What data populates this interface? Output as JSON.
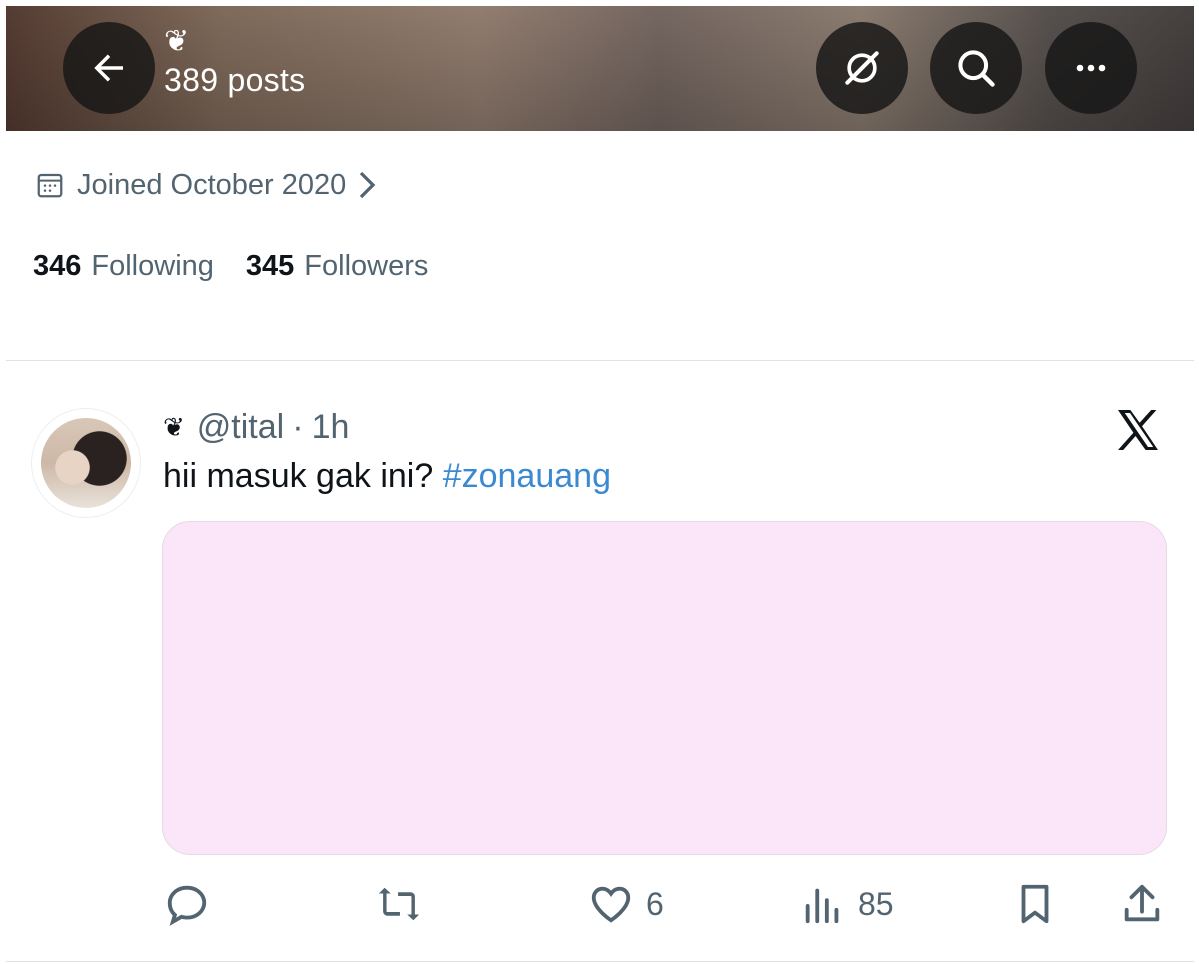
{
  "header": {
    "emoji": "❦",
    "post_count": "389 posts",
    "icons": [
      "back-arrow-icon",
      "grok-icon",
      "search-icon",
      "more-icon"
    ]
  },
  "profile": {
    "joined": "Joined October 2020",
    "following_count": "346",
    "following_label": "Following",
    "followers_count": "345",
    "followers_label": "Followers"
  },
  "post": {
    "emoji": "❦",
    "handle": "@tital",
    "separator": "·",
    "time": "1h",
    "text": "hii masuk gak ini?",
    "hashtag": "#zonauang",
    "media_color": "#fbe6f9",
    "actions": {
      "reply": "",
      "repost": "",
      "likes": "6",
      "views": "85"
    }
  },
  "colors": {
    "accent": "#3b89d0",
    "secondary_text": "#536471",
    "primary_text": "#0f1419"
  }
}
